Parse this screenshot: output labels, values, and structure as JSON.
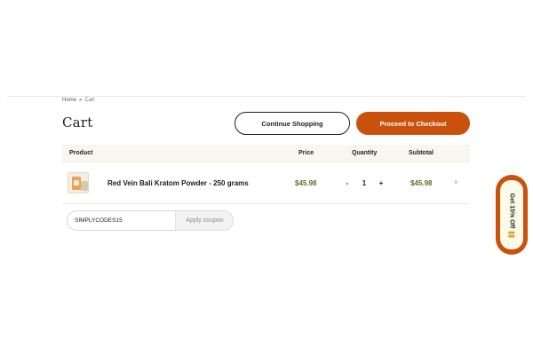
{
  "breadcrumb": {
    "home": "Home",
    "separator": "»",
    "current": "Cart"
  },
  "page": {
    "title": "Cart"
  },
  "actions": {
    "continue_shopping": "Continue Shopping",
    "checkout": "Proceed to Checkout"
  },
  "table": {
    "headers": {
      "product": "Product",
      "price": "Price",
      "quantity": "Quantity",
      "subtotal": "Subtotal"
    },
    "rows": [
      {
        "name": "Red Vein Bali Kratom Powder - 250 grams",
        "price": "$45.98",
        "qty_minus": "-",
        "quantity": "1",
        "qty_plus": "+",
        "subtotal": "$45.98",
        "remove": "×"
      }
    ]
  },
  "coupon": {
    "value": "SIMPLYCODES15",
    "apply_label": "Apply coupon"
  },
  "promo_tab": {
    "label": "Get 15% Off",
    "icon": "gift-icon"
  },
  "colors": {
    "accent": "#c9510c",
    "price_green": "#5d6b2a",
    "table_header_bg": "#f7f6f1"
  }
}
